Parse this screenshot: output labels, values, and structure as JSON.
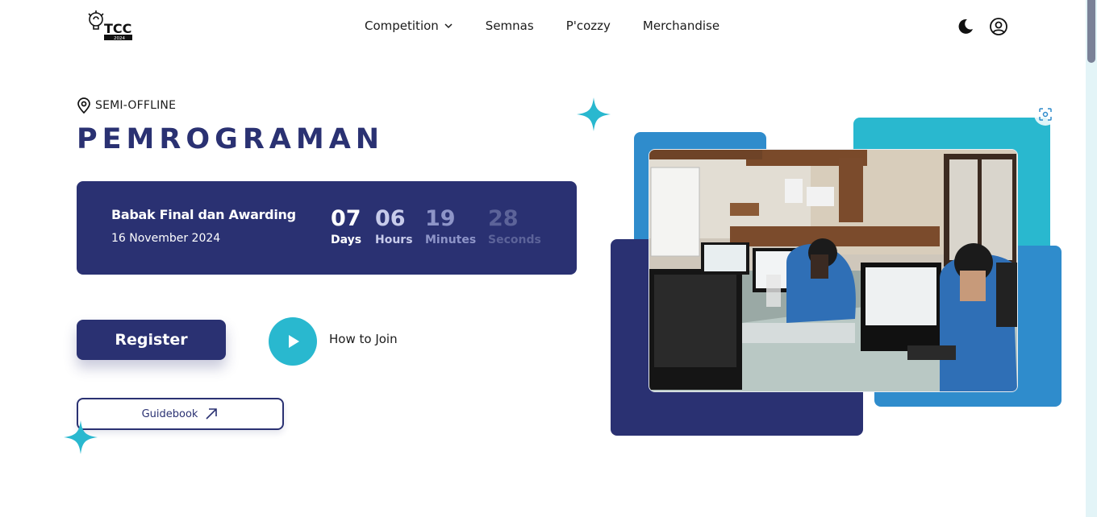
{
  "header": {
    "logo_text": "TCC",
    "logo_year": "2024",
    "nav": [
      {
        "label": "Competition",
        "has_dropdown": true
      },
      {
        "label": "Semnas"
      },
      {
        "label": "P'cozzy"
      },
      {
        "label": "Merchandise"
      }
    ],
    "icons": [
      "moon-icon",
      "user-icon"
    ]
  },
  "hero": {
    "location": "SEMI-OFFLINE",
    "title": "PEMROGRAMAN",
    "countdown": {
      "event": "Babak Final dan Awarding",
      "date": "16 November 2024",
      "units": [
        {
          "value": "07",
          "label": "Days"
        },
        {
          "value": "06",
          "label": "Hours"
        },
        {
          "value": "19",
          "label": "Minutes"
        },
        {
          "value": "28",
          "label": "Seconds"
        }
      ]
    },
    "register_label": "Register",
    "how_to_join_label": "How to Join",
    "guidebook_label": "Guidebook"
  },
  "colors": {
    "primary": "#2a3172",
    "accent": "#29b8cf",
    "blue": "#2f8ccc",
    "muted_blue": "#8e95c8",
    "dim_blue": "#5c6399"
  }
}
